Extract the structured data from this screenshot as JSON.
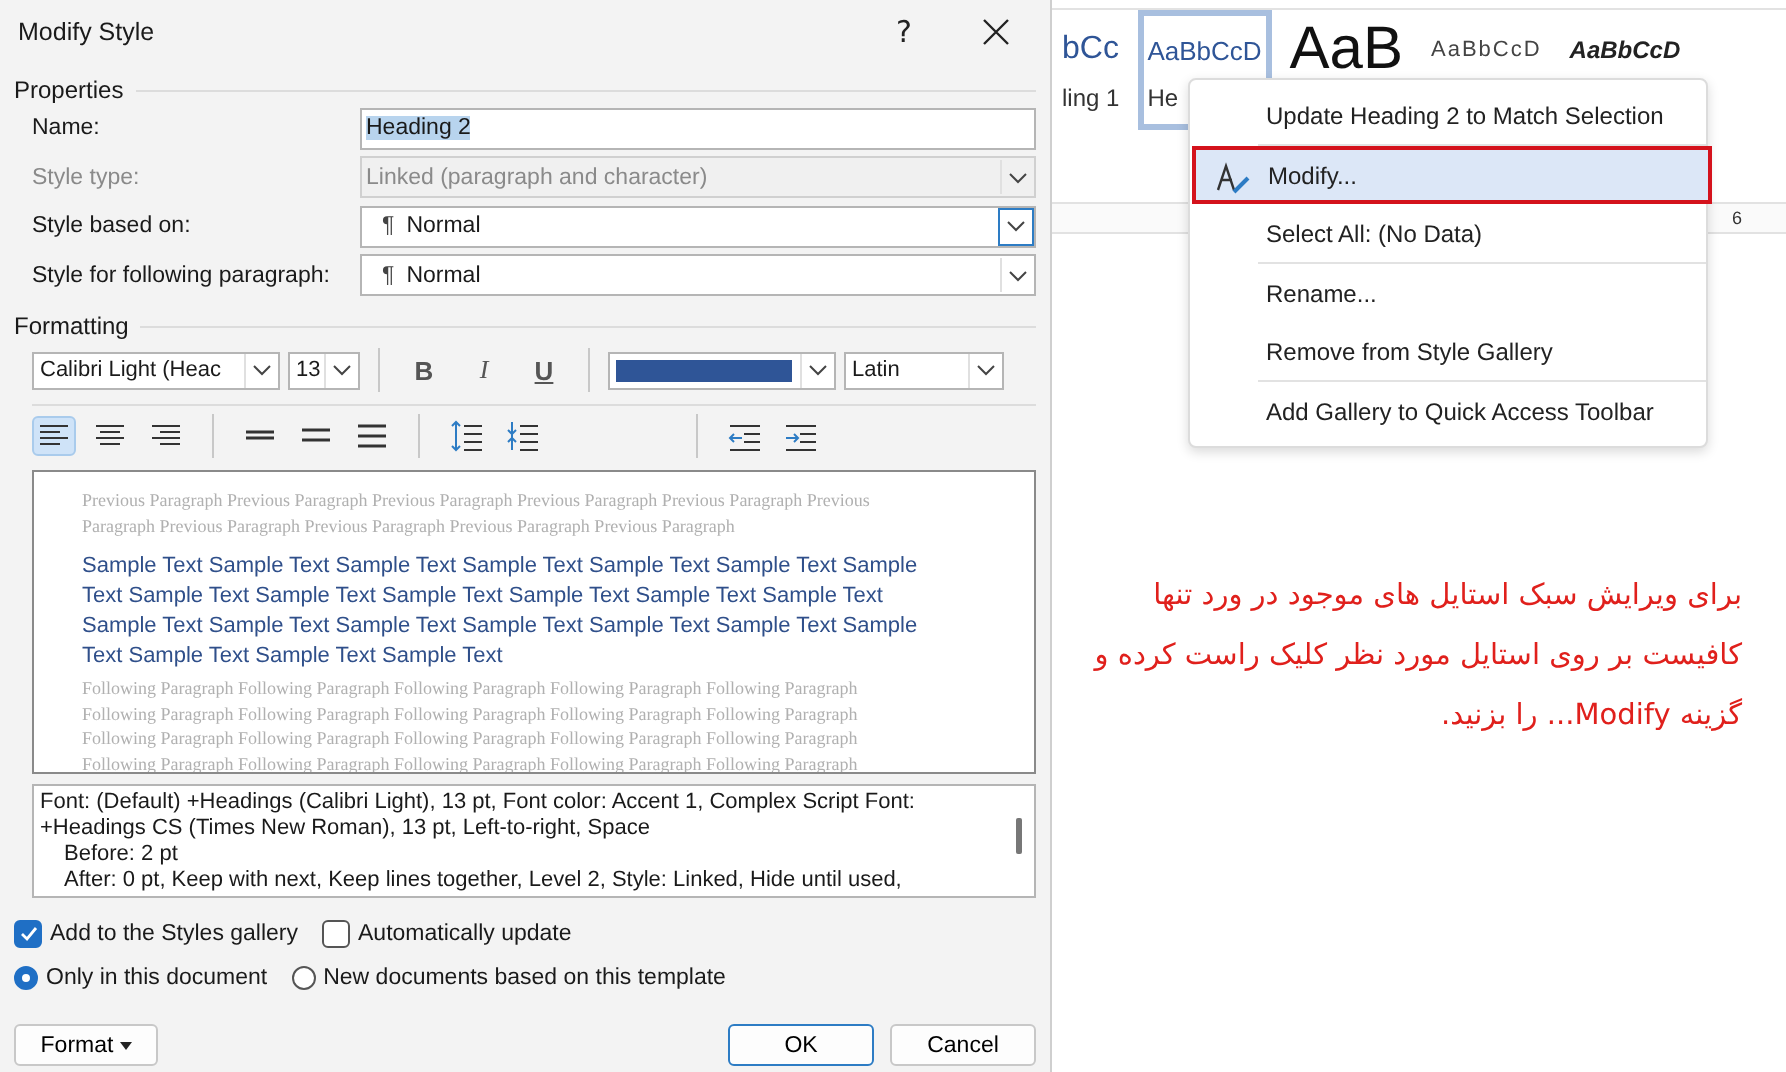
{
  "dialog": {
    "title": "Modify Style",
    "help": "?"
  },
  "properties": {
    "legend": "Properties",
    "fields": [
      {
        "label": "Name:",
        "kind": "text",
        "value": "Heading 2",
        "disabled": false,
        "text_selected": true
      },
      {
        "label": "Style type:",
        "kind": "combo",
        "value": "Linked (paragraph and character)",
        "disabled": true
      },
      {
        "label": "Style based on:",
        "kind": "combo",
        "value": "Normal",
        "pilcrow": "¶",
        "disabled": false,
        "focused": true
      },
      {
        "label": "Style for following paragraph:",
        "kind": "combo",
        "value": "Normal",
        "pilcrow": "¶",
        "disabled": false,
        "focused": false
      }
    ]
  },
  "formatting": {
    "legend": "Formatting",
    "font": "Calibri Light (Heac",
    "size": "13",
    "styles": [
      {
        "kind": "bold",
        "label": "B"
      },
      {
        "kind": "italic",
        "label": "I"
      },
      {
        "kind": "underline",
        "label": "U"
      }
    ],
    "script": "Latin",
    "paragraph_groups": [
      [
        {
          "kind": "align-left",
          "selected": true
        },
        {
          "kind": "align-center",
          "selected": false
        },
        {
          "kind": "align-right",
          "selected": false
        }
      ],
      [
        {
          "kind": "single-spacing",
          "selected": false
        },
        {
          "kind": "one-half-spacing",
          "selected": false
        },
        {
          "kind": "double-spacing",
          "selected": false
        }
      ],
      [
        {
          "kind": "increase-spacing",
          "selected": false
        },
        {
          "kind": "decrease-spacing",
          "selected": false
        }
      ],
      [
        {
          "kind": "decrease-indent",
          "selected": false
        },
        {
          "kind": "increase-indent",
          "selected": false
        }
      ]
    ]
  },
  "preview": {
    "previous": "Previous Paragraph Previous Paragraph Previous Paragraph Previous Paragraph Previous Paragraph Previous Paragraph Previous Paragraph Previous Paragraph Previous Paragraph Previous Paragraph",
    "sample": "Sample Text Sample Text Sample Text Sample Text Sample Text Sample Text Sample Text Sample Text Sample Text Sample Text Sample Text Sample Text Sample Text Sample Text Sample Text Sample Text Sample Text Sample Text Sample Text Sample Text Sample Text Sample Text Sample Text",
    "following": "Following Paragraph Following Paragraph Following Paragraph Following Paragraph Following Paragraph Following Paragraph Following Paragraph Following Paragraph Following Paragraph Following Paragraph Following Paragraph Following Paragraph Following Paragraph Following Paragraph Following Paragraph Following Paragraph Following Paragraph Following Paragraph Following Paragraph Following Paragraph"
  },
  "description": [
    "Font: (Default) +Headings (Calibri Light), 13 pt, Font color: Accent 1, Complex Script Font: +Headings CS (Times New Roman), 13 pt, Left-to-right, Space",
    "Before:  2 pt",
    "After:  0 pt, Keep with next, Keep lines together, Level 2, Style: Linked, Hide until used,"
  ],
  "checkboxes": [
    {
      "label": "Add to the Styles gallery",
      "checked": true
    },
    {
      "label": "Automatically update",
      "checked": false
    }
  ],
  "radios": [
    {
      "label": "Only in this document",
      "selected": true
    },
    {
      "label": "New documents based on this template",
      "selected": false
    }
  ],
  "buttons": {
    "format": "Format",
    "ok": "OK",
    "cancel": "Cancel"
  },
  "gallery": [
    {
      "preview": "bCc",
      "caption": "ling 1",
      "kind": "heading1",
      "selected": false
    },
    {
      "preview": "AaBbCcD",
      "caption": "He",
      "kind": "heading2",
      "selected": true
    },
    {
      "preview": "AaB",
      "kind": "title",
      "selected": false
    },
    {
      "preview": "AaBbCcD",
      "kind": "subtitle",
      "selected": false
    },
    {
      "preview": "AaBbCcD",
      "kind": "emphasis",
      "selected": false
    }
  ],
  "ruler_number": "6",
  "context_menu": [
    {
      "label": "Update Heading 2 to Match Selection",
      "highlighted": false,
      "icon": false,
      "separator_after": true
    },
    {
      "label": "Modify...",
      "highlighted": true,
      "icon": true,
      "separator_after": false
    },
    {
      "label": "Select All: (No Data)",
      "highlighted": false,
      "icon": false,
      "separator_after": true
    },
    {
      "label": "Rename...",
      "highlighted": false,
      "icon": false,
      "separator_after": false
    },
    {
      "label": "Remove from Style Gallery",
      "highlighted": false,
      "icon": false,
      "separator_after": true
    },
    {
      "label": "Add Gallery to Quick Access Toolbar",
      "highlighted": false,
      "icon": false,
      "separator_after": false
    }
  ],
  "note": "برای ویرایش سبک استایل های موجود در ورد تنها کافیست بر روی استایل مورد نظر کلیک راست کرده و گزینه Modify... را بزنید."
}
